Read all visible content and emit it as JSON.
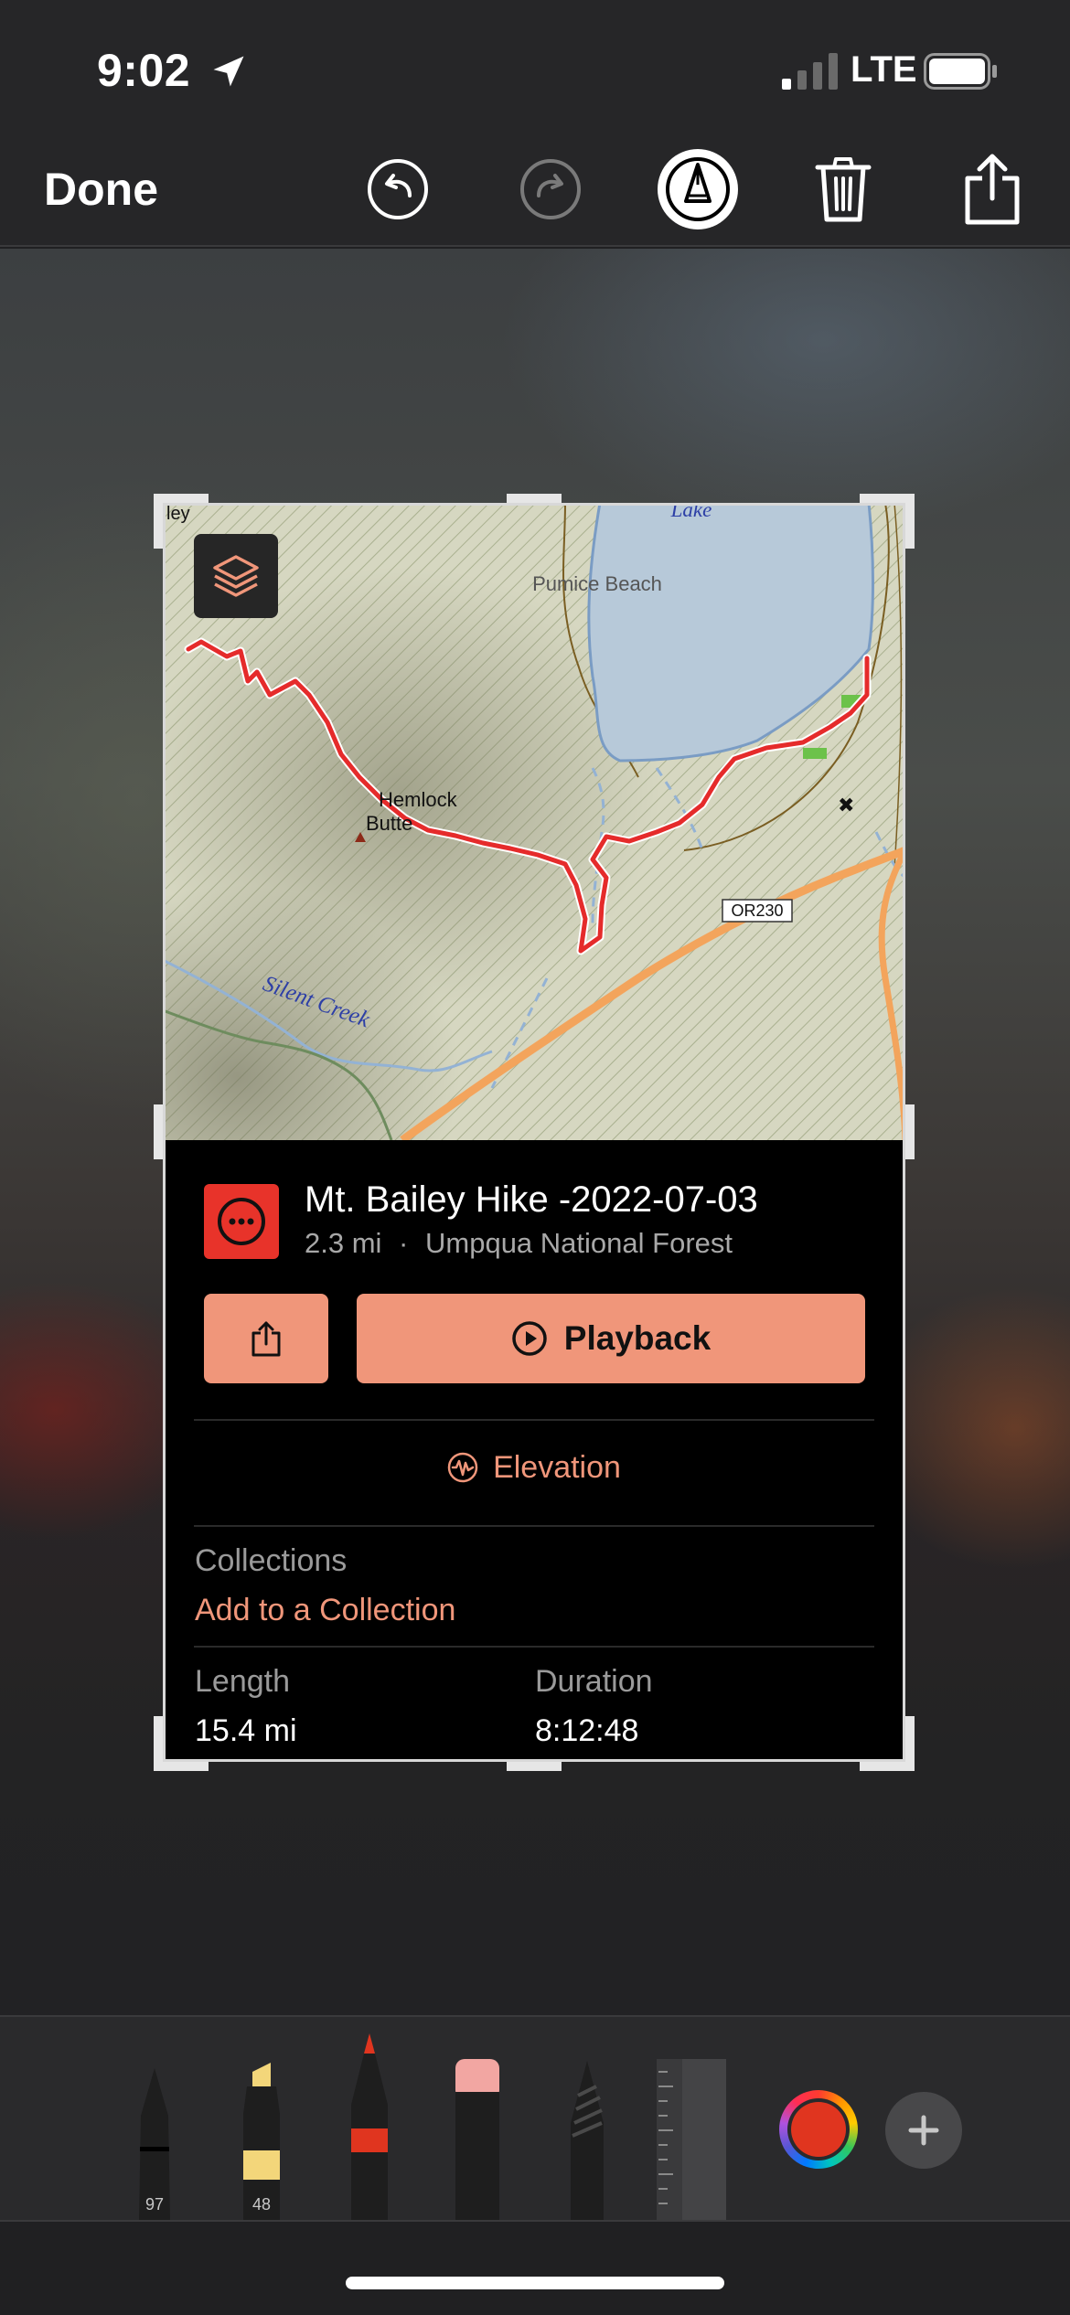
{
  "status_bar": {
    "time": "9:02",
    "network": "LTE"
  },
  "toolbar": {
    "done_label": "Done",
    "icons": [
      "undo-icon",
      "redo-icon",
      "markup-pen-icon",
      "trash-icon",
      "share-icon"
    ]
  },
  "map": {
    "labels": {
      "lake": "Lake",
      "pumice_beach": "Pumice Beach",
      "hemlock_butte": "Hemlock Butte",
      "silent_creek": "Silent Creek",
      "road": "OR230",
      "edge_left": "ley"
    }
  },
  "track": {
    "title": "Mt. Bailey Hike -2022-07-03",
    "distance": "2.3 mi",
    "separator": "·",
    "location": "Umpqua National Forest"
  },
  "buttons": {
    "playback": "Playback"
  },
  "elevation_label": "Elevation",
  "collections": {
    "label": "Collections",
    "link": "Add to a Collection"
  },
  "stats": {
    "length_label": "Length",
    "length_value": "15.4 mi",
    "duration_label": "Duration",
    "duration_value": "8:12:48"
  },
  "palette": {
    "tools": [
      {
        "name": "pen",
        "number": "97"
      },
      {
        "name": "marker",
        "number": "48"
      },
      {
        "name": "pencil"
      },
      {
        "name": "eraser"
      },
      {
        "name": "lasso"
      },
      {
        "name": "ruler"
      }
    ],
    "current_color": "#e0351f"
  },
  "colors": {
    "accent": "#f0967a",
    "track_icon": "#e8332a",
    "route": "#e52b2b"
  }
}
